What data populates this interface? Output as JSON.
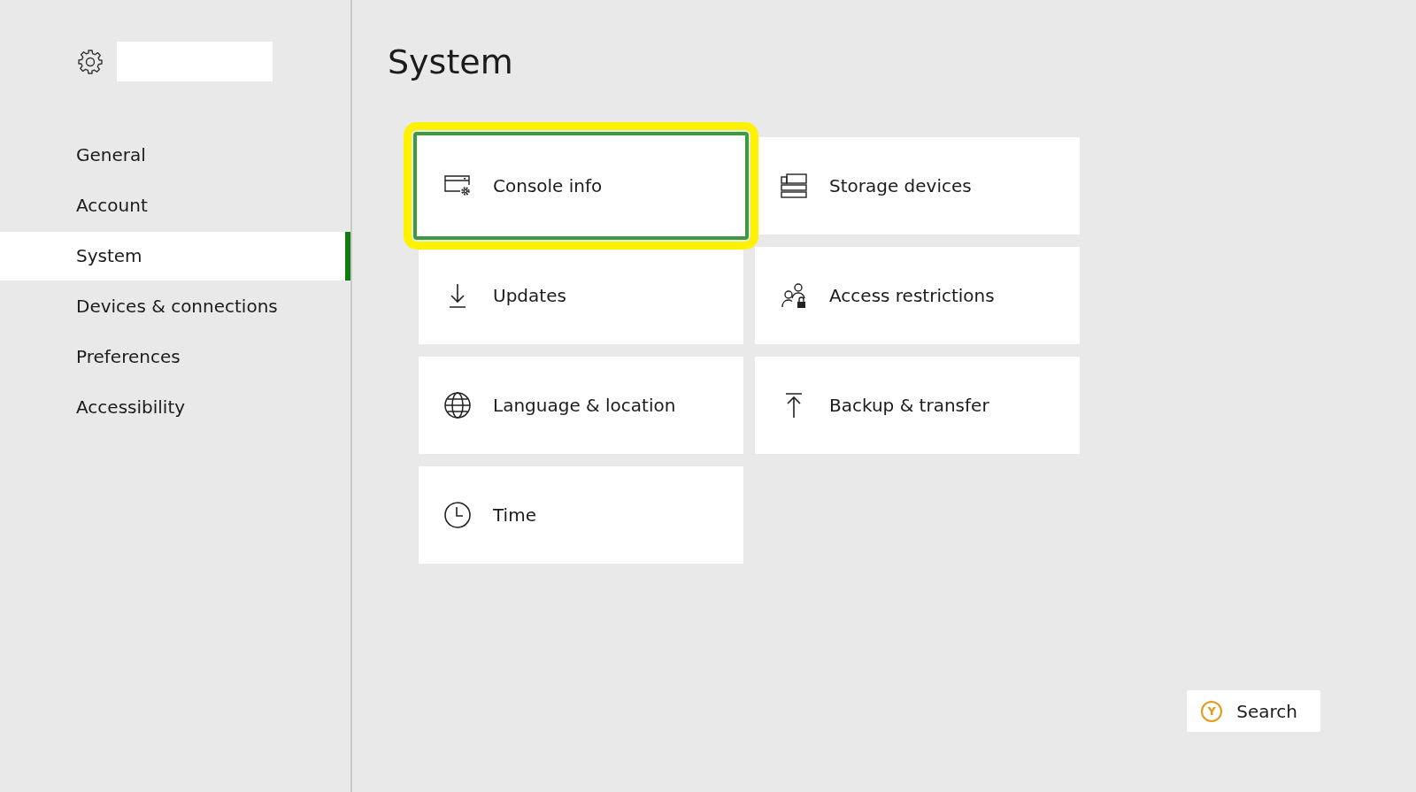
{
  "sidebar": {
    "items": [
      {
        "label": "General",
        "selected": false
      },
      {
        "label": "Account",
        "selected": false
      },
      {
        "label": "System",
        "selected": true
      },
      {
        "label": "Devices & connections",
        "selected": false
      },
      {
        "label": "Preferences",
        "selected": false
      },
      {
        "label": "Accessibility",
        "selected": false
      }
    ]
  },
  "page": {
    "title": "System"
  },
  "tiles": [
    {
      "label": "Console info",
      "kind": "console",
      "selected": true
    },
    {
      "label": "Storage devices",
      "kind": "storage",
      "selected": false
    },
    {
      "label": "Updates",
      "kind": "download",
      "selected": false
    },
    {
      "label": "Access restrictions",
      "kind": "access",
      "selected": false
    },
    {
      "label": "Language & location",
      "kind": "globe",
      "selected": false
    },
    {
      "label": "Backup & transfer",
      "kind": "upload",
      "selected": false
    },
    {
      "label": "Time",
      "kind": "clock",
      "selected": false
    }
  ],
  "search_button": {
    "glyph": "Y",
    "label": "Search"
  }
}
